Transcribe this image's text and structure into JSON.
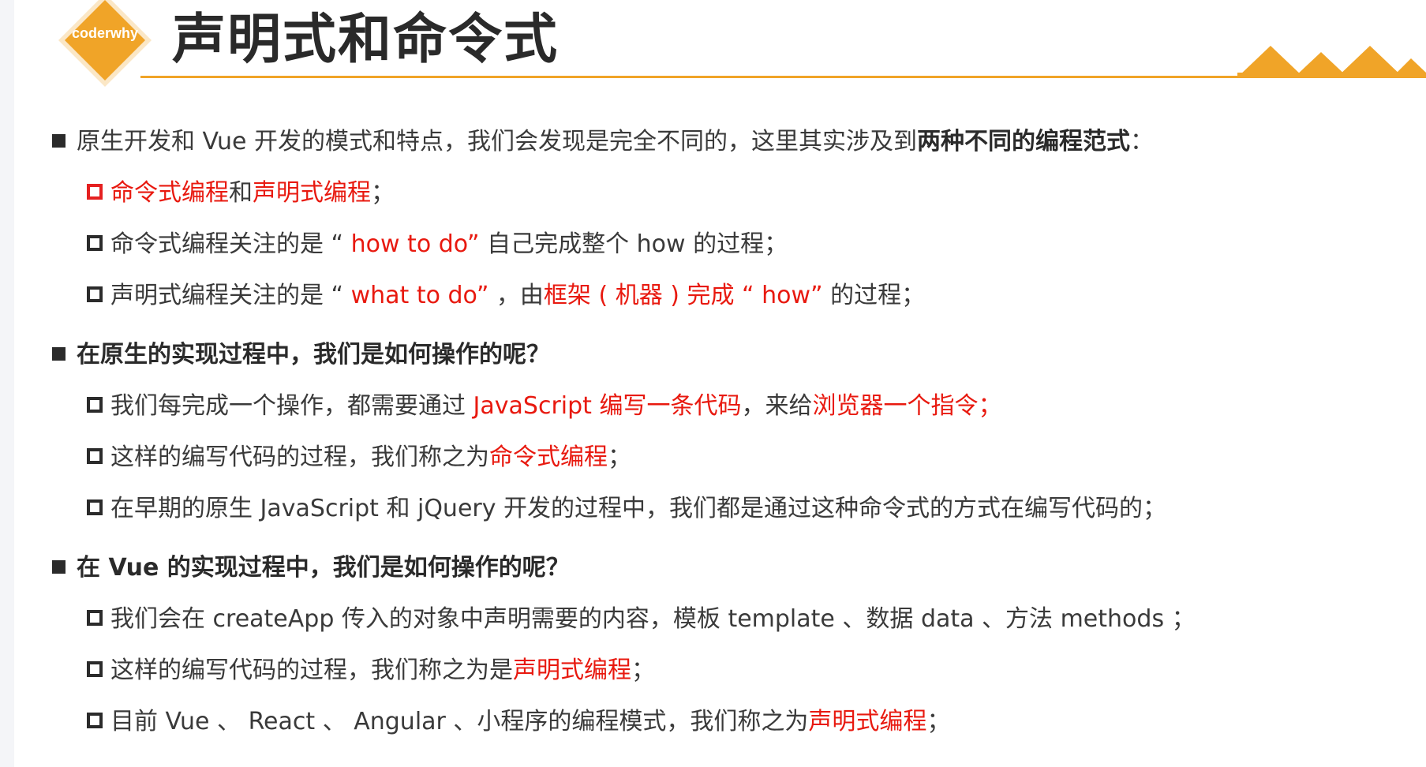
{
  "brand": {
    "logo_text": "coderwhy",
    "accent_color": "#f0a428",
    "highlight_color": "#e8190f"
  },
  "title": "声明式和命令式",
  "sections": [
    {
      "heading_pre": "原生开发和 Vue 开发的模式和特点，我们会发现是完全不同的，这里其实涉及到",
      "heading_bold": "两种不同的编程范式",
      "heading_post": "：",
      "items": [
        {
          "red1": "命令式编程",
          "mid": "和",
          "red2": "声明式编程",
          "tail": "；"
        },
        {
          "pre": "命令式编程关注的是 “",
          "red": " how to do”",
          "post": " 自己完成整个 how 的过程；"
        },
        {
          "pre": "声明式编程关注的是 “",
          "red": " what to do”",
          "mid": " ，由",
          "red2": "框架 ( 机器 ) 完成 “ how”",
          "post": " 的过程；"
        }
      ]
    },
    {
      "heading": "在原生的实现过程中，我们是如何操作的呢？",
      "items": [
        {
          "pre": "我们每完成一个操作，都需要通过 ",
          "red": "JavaScript 编写一条代码",
          "mid": "，来给",
          "red2": "浏览器一个指令；"
        },
        {
          "pre": "这样的编写代码的过程，我们称之为",
          "red": "命令式编程",
          "post": "；"
        },
        {
          "text": "在早期的原生 JavaScript 和 jQuery 开发的过程中，我们都是通过这种命令式的方式在编写代码的；"
        }
      ]
    },
    {
      "heading": "在 Vue 的实现过程中，我们是如何操作的呢？",
      "items": [
        {
          "text": "我们会在 createApp 传入的对象中声明需要的内容，模板 template 、数据 data 、方法 methods ；"
        },
        {
          "pre": "这样的编写代码的过程，我们称之为是",
          "red": "声明式编程",
          "post": "；"
        },
        {
          "pre": "目前 Vue 、 React 、 Angular 、小程序的编程模式，我们称之为",
          "red": "声明式编程",
          "post": "；"
        }
      ]
    }
  ]
}
